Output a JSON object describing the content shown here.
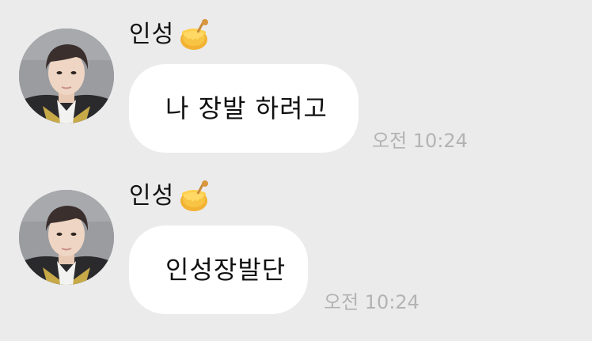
{
  "conversation": {
    "messages": [
      {
        "sender": "인성",
        "sender_icon": "honey-pot-emoji",
        "text": "나 장발 하려고",
        "time": "오전 10:24"
      },
      {
        "sender": "인성",
        "sender_icon": "honey-pot-emoji",
        "text": "인성장발단",
        "time": "오전 10:24"
      }
    ]
  },
  "colors": {
    "background": "#ebebeb",
    "bubble": "#ffffff",
    "text": "#111111",
    "timestamp": "#b3b3b3"
  }
}
